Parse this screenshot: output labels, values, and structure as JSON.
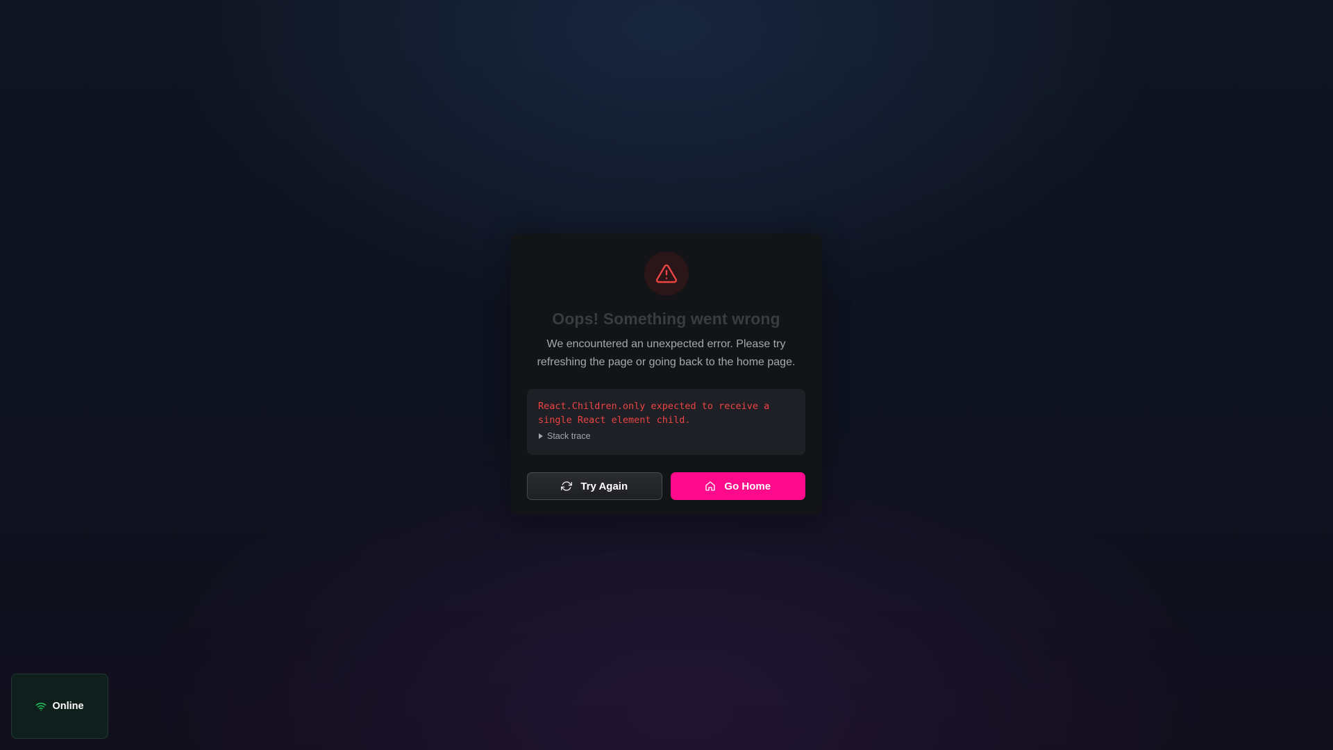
{
  "error": {
    "title": "Oops! Something went wrong",
    "message": "We encountered an unexpected error. Please try refreshing the page or going back to the home page.",
    "details": "React.Children.only expected to receive a single React element child.",
    "stack_label": "Stack trace"
  },
  "actions": {
    "try_again_label": "Try Again",
    "go_home_label": "Go Home"
  },
  "status": {
    "label": "Online"
  },
  "colors": {
    "accent": "#ff0a8a",
    "error": "#ef4444",
    "online": "#22c55e"
  },
  "icons": {
    "alert": "alert-triangle-icon",
    "retry": "refresh-icon",
    "home": "home-icon",
    "status": "wifi-icon"
  }
}
